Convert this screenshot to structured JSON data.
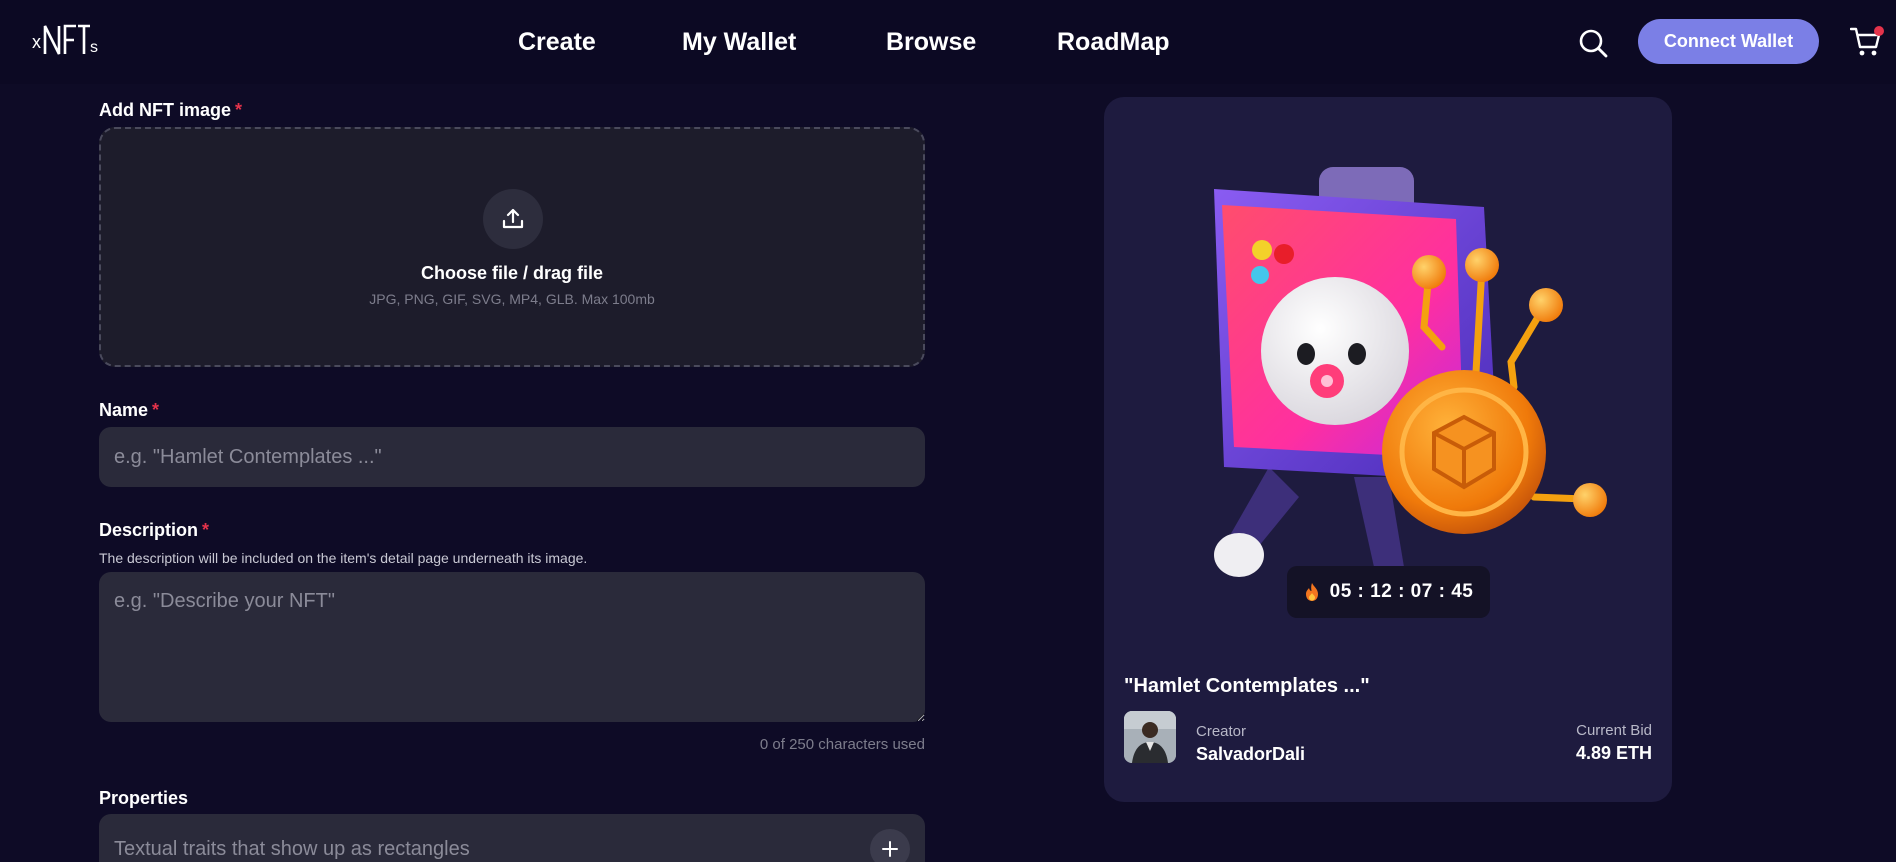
{
  "header": {
    "logo_text": "xNFTs",
    "nav": [
      {
        "label": "Create"
      },
      {
        "label": "My Wallet"
      },
      {
        "label": "Browse"
      },
      {
        "label": "RoadMap"
      }
    ],
    "connect_label": "Connect Wallet"
  },
  "form": {
    "image": {
      "label": "Add NFT image",
      "required_mark": "*",
      "drop_title": "Choose file / drag file",
      "drop_sub": "JPG, PNG, GIF, SVG, MP4, GLB. Max 100mb"
    },
    "name": {
      "label": "Name",
      "required_mark": "*",
      "placeholder": "e.g. \"Hamlet Contemplates ...\""
    },
    "description": {
      "label": "Description",
      "required_mark": "*",
      "help": "The description will be included on the item's detail page underneath its image.",
      "placeholder": "e.g. \"Describe your NFT\"",
      "counter": "0 of 250 characters used"
    },
    "properties": {
      "label": "Properties",
      "placeholder": "Textual traits that show up as rectangles"
    }
  },
  "preview": {
    "timer": "05 : 12 : 07 : 45",
    "title": "\"Hamlet Contemplates ...\"",
    "creator_label": "Creator",
    "creator_name": "SalvadorDali",
    "bid_label": "Current Bid",
    "bid_value": "4.89 ETH"
  },
  "colors": {
    "background": "#0e0b26",
    "accent": "#7b7fe6",
    "required": "#e5334b",
    "card": "#1e1b3f",
    "input": "#2a2a3a"
  }
}
